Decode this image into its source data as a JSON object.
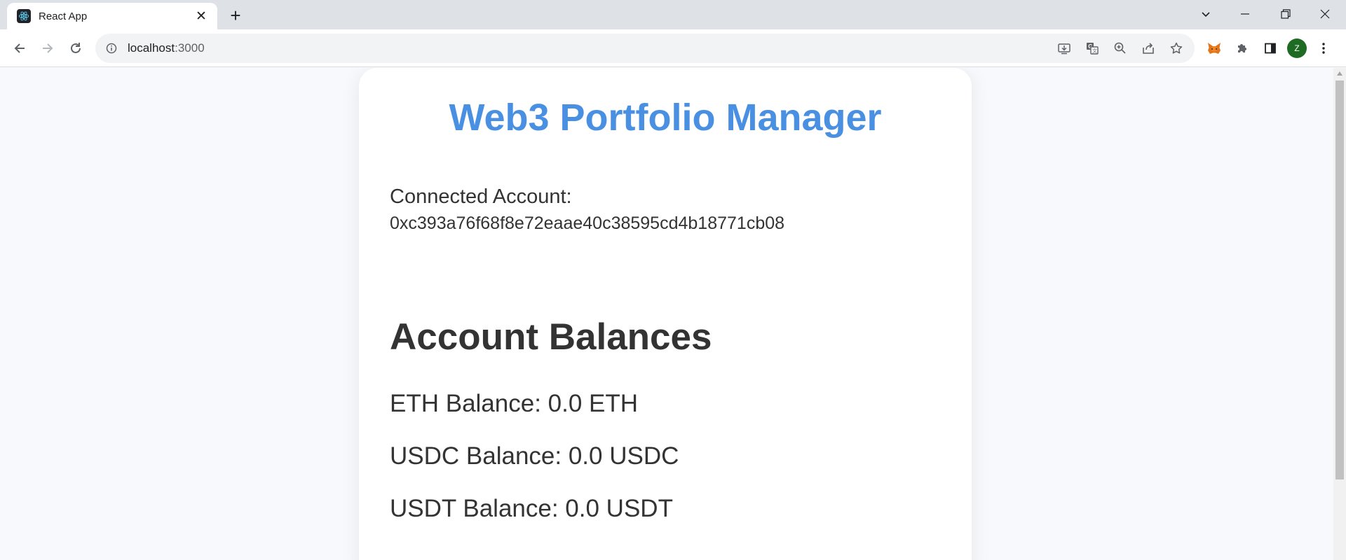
{
  "browser": {
    "tab_title": "React App",
    "tab_close": "✕",
    "new_tab": "+",
    "url_host": "localhost",
    "url_port": ":3000",
    "profile_initial": "Z"
  },
  "icons": {
    "favicon": "react-logo-icon",
    "back": "arrow-left-icon",
    "forward": "arrow-right-icon",
    "reload": "reload-icon",
    "site_info": "info-icon",
    "install": "install-app-icon",
    "translate": "translate-icon",
    "zoom": "zoom-icon",
    "share": "share-icon",
    "bookmark": "star-icon",
    "metamask": "metamask-fox-icon",
    "extensions": "puzzle-icon",
    "side_panel": "side-panel-icon"
  },
  "colors": {
    "title": "#4a90e2",
    "text": "#333333",
    "avatar": "#1e6b23"
  },
  "page": {
    "title": "Web3 Portfolio Manager",
    "account_label": "Connected Account:",
    "account_address": "0xc393a76f68f8e72eaae40c38595cd4b18771cb08",
    "balances_heading": "Account Balances",
    "balances": [
      "ETH Balance: 0.0 ETH",
      "USDC Balance: 0.0 USDC",
      "USDT Balance: 0.0 USDT"
    ]
  }
}
